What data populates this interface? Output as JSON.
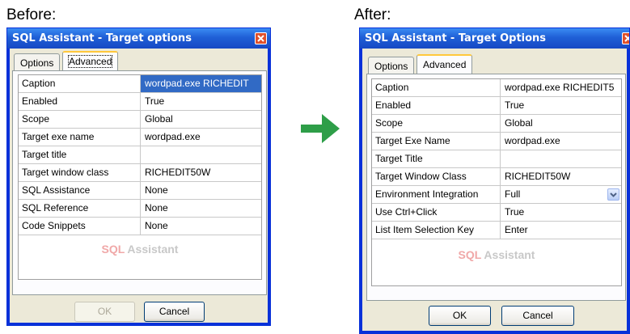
{
  "before": {
    "label": "Before:",
    "title": "SQL Assistant - Target options",
    "tabs": [
      "Options",
      "Advanced"
    ],
    "rows": [
      {
        "key": "Caption",
        "value": "wordpad.exe RICHEDIT"
      },
      {
        "key": "Enabled",
        "value": "True"
      },
      {
        "key": "Scope",
        "value": "Global"
      },
      {
        "key": "Target exe name",
        "value": "wordpad.exe"
      },
      {
        "key": "Target title",
        "value": ""
      },
      {
        "key": "Target window class",
        "value": "RICHEDIT50W"
      },
      {
        "key": "SQL Assistance",
        "value": "None"
      },
      {
        "key": "SQL Reference",
        "value": "None"
      },
      {
        "key": "Code Snippets",
        "value": "None"
      }
    ],
    "watermark_a": "SQL",
    "watermark_b": " Assistant",
    "ok_label": "OK",
    "cancel_label": "Cancel"
  },
  "after": {
    "label": "After:",
    "title": "SQL Assistant - Target Options",
    "tabs": [
      "Options",
      "Advanced"
    ],
    "rows": [
      {
        "key": "Caption",
        "value": "wordpad.exe RICHEDIT5"
      },
      {
        "key": "Enabled",
        "value": "True"
      },
      {
        "key": "Scope",
        "value": "Global"
      },
      {
        "key": "Target Exe Name",
        "value": "wordpad.exe"
      },
      {
        "key": "Target Title",
        "value": ""
      },
      {
        "key": "Target Window Class",
        "value": "RICHEDIT50W"
      },
      {
        "key": "Environment Integration",
        "value": "Full"
      },
      {
        "key": "Use Ctrl+Click",
        "value": "True"
      },
      {
        "key": "List Item Selection Key",
        "value": "Enter"
      }
    ],
    "watermark_a": "SQL",
    "watermark_b": " Assistant",
    "ok_label": "OK",
    "cancel_label": "Cancel"
  },
  "colors": {
    "arrow": "#2e9e48",
    "title_bar": "#1f5fd6",
    "selection": "#316ac5"
  },
  "icons": {
    "arrow": "right-arrow-icon",
    "close": "close-icon",
    "dropdown": "chevron-down-icon"
  }
}
